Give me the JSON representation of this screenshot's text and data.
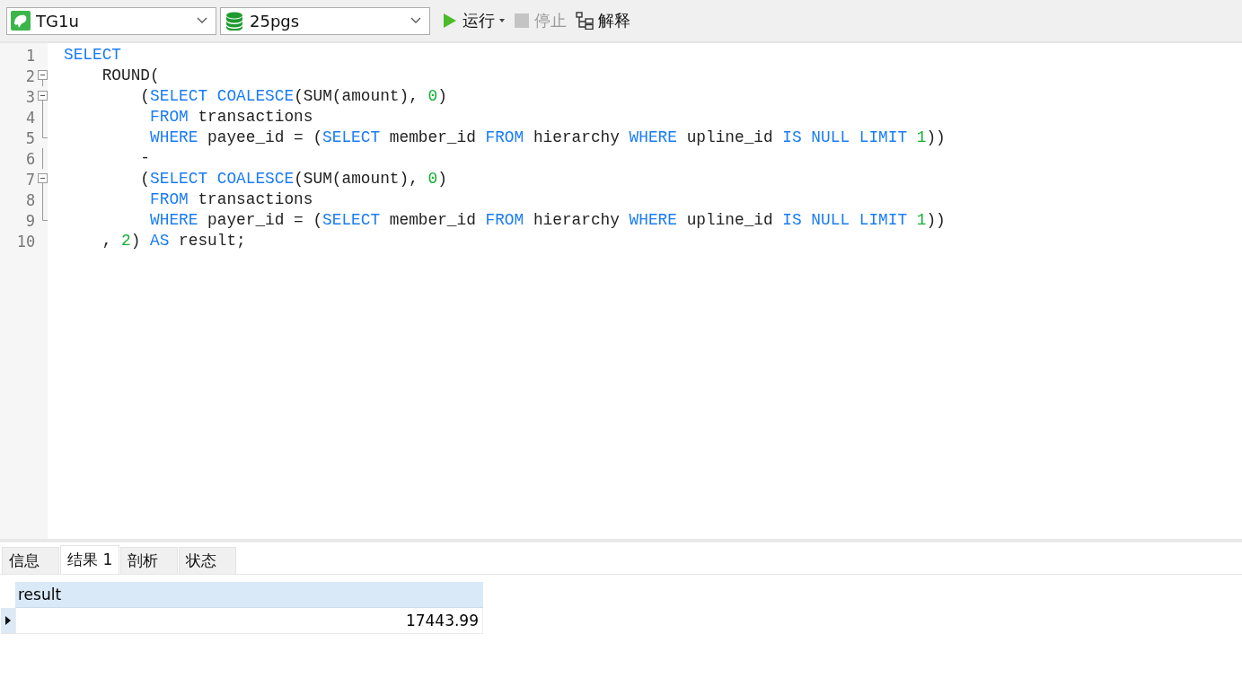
{
  "toolbar": {
    "connection": {
      "value": "TG1u"
    },
    "database": {
      "value": "25pgs"
    },
    "buttons": [
      {
        "kind": "run",
        "label": "运行",
        "disabled": false,
        "menu": true
      },
      {
        "kind": "stop",
        "label": "停止",
        "disabled": true,
        "menu": false
      },
      {
        "kind": "explain",
        "label": "解释",
        "disabled": false,
        "menu": false
      }
    ]
  },
  "editor": {
    "lines": [
      {
        "number": "1",
        "kind": "plain",
        "tokens": [
          {
            "t": "SELECT",
            "kind": "kw"
          }
        ]
      },
      {
        "number": "2",
        "kind": "header",
        "tokens": [
          {
            "t": "    ROUND(",
            "kind": "text"
          }
        ]
      },
      {
        "number": "3",
        "kind": "header",
        "tokens": [
          {
            "t": "        (",
            "kind": "text"
          },
          {
            "t": "SELECT",
            "kind": "kw"
          },
          {
            "t": " COALESCE",
            "kind": "kw"
          },
          {
            "t": "(SUM(amount), ",
            "kind": "text"
          },
          {
            "t": "0",
            "kind": "num"
          },
          {
            "t": ")",
            "kind": "text"
          }
        ]
      },
      {
        "number": "4",
        "kind": "body",
        "tokens": [
          {
            "t": "         FROM",
            "kind": "kw"
          },
          {
            "t": " transactions",
            "kind": "text"
          }
        ]
      },
      {
        "number": "5",
        "kind": "last",
        "tokens": [
          {
            "t": "         WHERE",
            "kind": "kw"
          },
          {
            "t": " payee_id = (",
            "kind": "text"
          },
          {
            "t": "SELECT",
            "kind": "kw"
          },
          {
            "t": " member_id ",
            "kind": "text"
          },
          {
            "t": "FROM",
            "kind": "kw"
          },
          {
            "t": " hierarchy ",
            "kind": "text"
          },
          {
            "t": "WHERE",
            "kind": "kw"
          },
          {
            "t": " upline_id ",
            "kind": "text"
          },
          {
            "t": "IS NULL LIMIT",
            "kind": "kw"
          },
          {
            "t": " 1",
            "kind": "num"
          },
          {
            "t": "))",
            "kind": "text"
          }
        ]
      },
      {
        "number": "6",
        "kind": "body",
        "tokens": [
          {
            "t": "        -",
            "kind": "text"
          }
        ]
      },
      {
        "number": "7",
        "kind": "header",
        "tokens": [
          {
            "t": "        (",
            "kind": "text"
          },
          {
            "t": "SELECT",
            "kind": "kw"
          },
          {
            "t": " COALESCE",
            "kind": "kw"
          },
          {
            "t": "(SUM(amount), ",
            "kind": "text"
          },
          {
            "t": "0",
            "kind": "num"
          },
          {
            "t": ")",
            "kind": "text"
          }
        ]
      },
      {
        "number": "8",
        "kind": "body",
        "tokens": [
          {
            "t": "         FROM",
            "kind": "kw"
          },
          {
            "t": " transactions",
            "kind": "text"
          }
        ]
      },
      {
        "number": "9",
        "kind": "last",
        "tokens": [
          {
            "t": "         WHERE",
            "kind": "kw"
          },
          {
            "t": " payer_id = (",
            "kind": "text"
          },
          {
            "t": "SELECT",
            "kind": "kw"
          },
          {
            "t": " member_id ",
            "kind": "text"
          },
          {
            "t": "FROM",
            "kind": "kw"
          },
          {
            "t": " hierarchy ",
            "kind": "text"
          },
          {
            "t": "WHERE",
            "kind": "kw"
          },
          {
            "t": " upline_id ",
            "kind": "text"
          },
          {
            "t": "IS NULL LIMIT",
            "kind": "kw"
          },
          {
            "t": " 1",
            "kind": "num"
          },
          {
            "t": "))",
            "kind": "text"
          }
        ]
      },
      {
        "number": "10",
        "kind": "plain",
        "tokens": [
          {
            "t": "    , ",
            "kind": "text"
          },
          {
            "t": "2",
            "kind": "num"
          },
          {
            "t": ") ",
            "kind": "text"
          },
          {
            "t": "AS",
            "kind": "kw"
          },
          {
            "t": " result;",
            "kind": "text"
          }
        ]
      }
    ]
  },
  "results": {
    "tabs": [
      {
        "label": "信息",
        "selected": false
      },
      {
        "label": "结果 1",
        "selected": true
      },
      {
        "label": "剖析",
        "selected": false
      },
      {
        "label": "状态",
        "selected": false
      }
    ],
    "table": {
      "columns": [
        "result"
      ],
      "rows": [
        {
          "current": true,
          "cells": [
            "17443.99"
          ]
        }
      ]
    }
  }
}
